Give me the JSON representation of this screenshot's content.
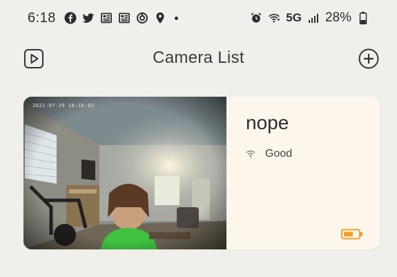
{
  "status_bar": {
    "time": "6:18",
    "network": "5G",
    "battery_percent": "28%",
    "icons": [
      "facebook-icon",
      "twitter-icon",
      "news-icon",
      "news-icon",
      "sync-icon",
      "location-pin-icon",
      "dot-icon",
      "alarm-icon",
      "wifi-icon",
      "signal-icon",
      "battery-icon"
    ]
  },
  "header": {
    "title": "Camera List",
    "left_icon": "playback-icon",
    "right_icon": "add-circle-icon"
  },
  "cameras": [
    {
      "name": "nope",
      "timestamp": "2021-07-29 18:16:02",
      "signal_label": "Good",
      "signal_icon": "wifi-icon",
      "battery_icon": "battery-icon",
      "battery_color": "#f0a028"
    }
  ],
  "colors": {
    "background": "#f1efeb",
    "card": "#fdf6ec",
    "battery_accent": "#f0a028"
  }
}
